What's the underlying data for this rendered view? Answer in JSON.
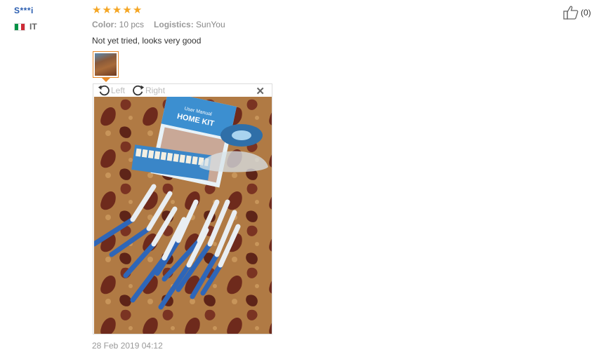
{
  "buyer": {
    "name": "S***i",
    "country": "IT",
    "flag_colors": [
      "#009246",
      "#ffffff",
      "#ce2b37"
    ]
  },
  "feedback": {
    "rating": 5,
    "star_color": "#f5a623",
    "color_label": "Color:",
    "color_value": "10 pcs",
    "logistics_label": "Logistics:",
    "logistics_value": "SunYou",
    "text": "Not yet tried, looks very good",
    "date": "28 Feb 2019 04:12"
  },
  "viewer": {
    "rotate_left_label": "Left",
    "rotate_right_label": "Right",
    "close_icon": "close-icon",
    "photo": {
      "manual_title": "HOME KIT",
      "manual_subtitle": "User Manual"
    }
  },
  "helpful": {
    "icon": "thumbs-up-icon",
    "count": "(0)"
  }
}
